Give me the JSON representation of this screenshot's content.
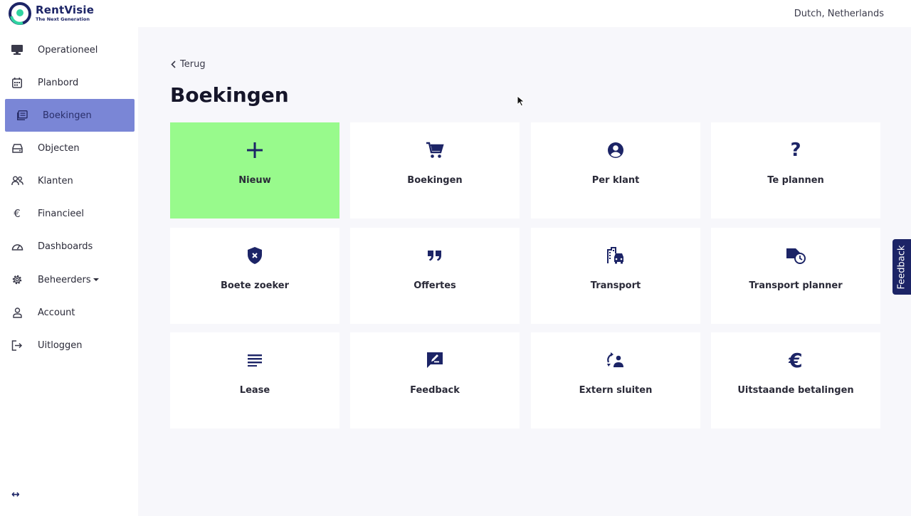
{
  "brand": {
    "name": "RentVisie",
    "tagline": "The Next Generation",
    "color": "#1c2466"
  },
  "language": "Dutch, Netherlands",
  "sidebar": {
    "items": [
      {
        "label": "Operationeel",
        "icon": "monitor-icon"
      },
      {
        "label": "Planbord",
        "icon": "calendar-icon"
      },
      {
        "label": "Boekingen",
        "icon": "bookings-icon",
        "active": true
      },
      {
        "label": "Objecten",
        "icon": "drive-icon"
      },
      {
        "label": "Klanten",
        "icon": "users-icon"
      },
      {
        "label": "Financieel",
        "icon": "euro-icon"
      },
      {
        "label": "Dashboards",
        "icon": "gauge-icon"
      },
      {
        "label": "Beheerders",
        "icon": "gear-icon",
        "dropdown": true
      },
      {
        "label": "Account",
        "icon": "user-icon"
      },
      {
        "label": "Uitloggen",
        "icon": "logout-icon"
      }
    ],
    "collapse_symbol": "↔"
  },
  "main": {
    "back_label": "Terug",
    "title": "Boekingen",
    "tiles": [
      {
        "label": "Nieuw",
        "icon": "plus-icon"
      },
      {
        "label": "Boekingen",
        "icon": "cart-icon"
      },
      {
        "label": "Per klant",
        "icon": "account-circle-icon"
      },
      {
        "label": "Te plannen",
        "icon": "question-icon"
      },
      {
        "label": "Boete zoeker",
        "icon": "shield-x-icon"
      },
      {
        "label": "Offertes",
        "icon": "quote-icon"
      },
      {
        "label": "Transport",
        "icon": "city-car-icon"
      },
      {
        "label": "Transport planner",
        "icon": "truck-clock-icon"
      },
      {
        "label": "Lease",
        "icon": "text-lines-icon"
      },
      {
        "label": "Feedback",
        "icon": "feedback-icon"
      },
      {
        "label": "Extern sluiten",
        "icon": "exchange-person-icon"
      },
      {
        "label": "Uitstaande betalingen",
        "icon": "euro-icon"
      }
    ]
  },
  "feedback_tab": "Feedback",
  "colors": {
    "accent": "#7a86d6",
    "new_tile": "#98fa8c",
    "icon": "#1c2466"
  }
}
